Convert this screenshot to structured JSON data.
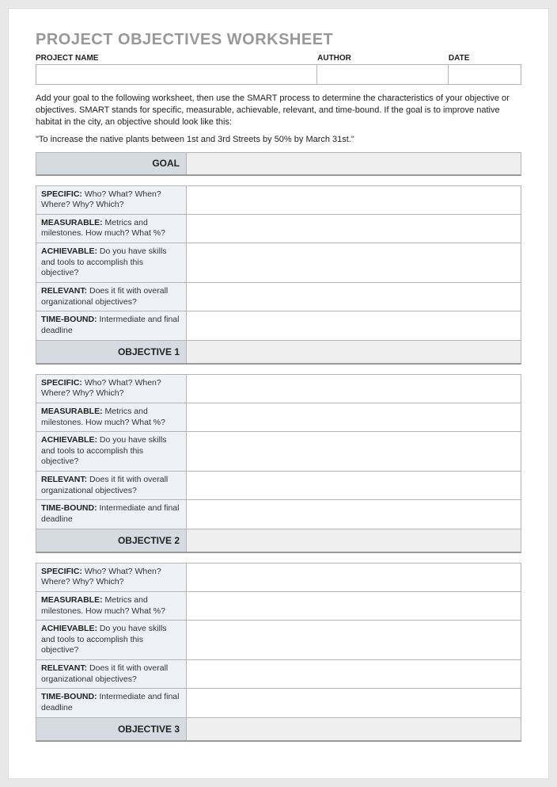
{
  "title": "PROJECT OBJECTIVES WORKSHEET",
  "header": {
    "project_label": "PROJECT NAME",
    "project_value": "",
    "author_label": "AUTHOR",
    "author_value": "",
    "date_label": "DATE",
    "date_value": ""
  },
  "instructions": "Add your goal to the following worksheet, then use the SMART process to determine the characteristics of your objective or objectives. SMART stands for specific, measurable, achievable, relevant, and time-bound. If the goal is to improve native habitat in the city, an objective should look like this:",
  "example": "\"To increase the native plants between 1st and 3rd Streets by 50% by March 31st.\"",
  "goal_label": "GOAL",
  "goal_value": "",
  "smart": {
    "specific_bold": "SPECIFIC:",
    "specific_text": " Who? What? When? Where? Why? Which?",
    "measurable_bold": "MEASURABLE:",
    "measurable_text": " Metrics and milestones. How much? What %?",
    "achievable_bold": "ACHIEVABLE:",
    "achievable_text": " Do you have skills and tools to accomplish this objective?",
    "relevant_bold": "RELEVANT:",
    "relevant_text": " Does it fit with overall organizational objectives?",
    "timebound_bold": "TIME-BOUND:",
    "timebound_text": " Intermediate and final deadline"
  },
  "objectives": {
    "obj1_label": "OBJECTIVE 1",
    "obj2_label": "OBJECTIVE 2",
    "obj3_label": "OBJECTIVE 3"
  }
}
